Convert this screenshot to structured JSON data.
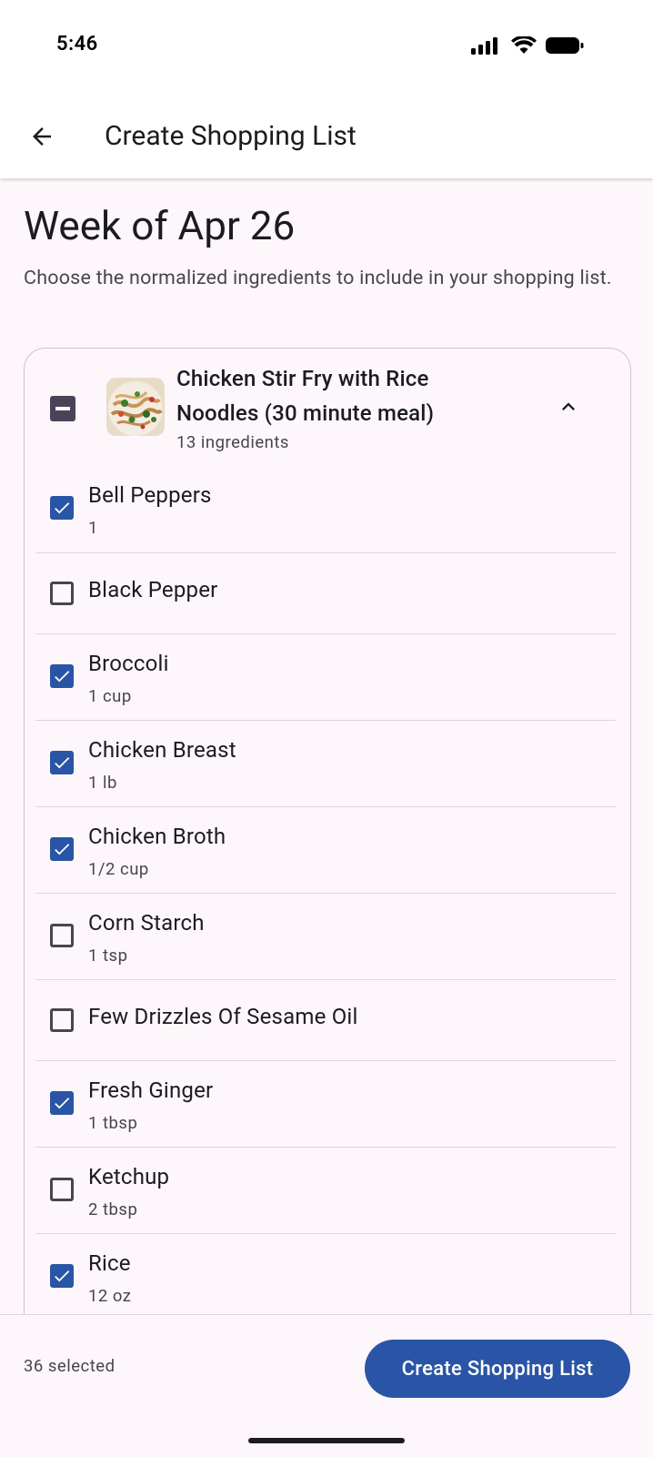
{
  "status_bar": {
    "time": "5:46"
  },
  "app_bar": {
    "title": "Create Shopping List",
    "back_icon": "arrow-left-icon"
  },
  "header": {
    "week_title": "Week of Apr 26",
    "subtitle": "Choose the normalized ingredients to include in your shopping list."
  },
  "recipe": {
    "name": "Chicken Stir Fry with Rice Noodles (30 minute meal)",
    "ingredient_count": "13 ingredients",
    "selection_state": "partial",
    "expanded": true
  },
  "ingredients": [
    {
      "name": "Bell Peppers",
      "qty": "1",
      "checked": true
    },
    {
      "name": "Black Pepper",
      "qty": "",
      "checked": false
    },
    {
      "name": "Broccoli",
      "qty": "1 cup",
      "checked": true
    },
    {
      "name": "Chicken Breast",
      "qty": "1 lb",
      "checked": true
    },
    {
      "name": "Chicken Broth",
      "qty": "1/2 cup",
      "checked": true
    },
    {
      "name": "Corn Starch",
      "qty": "1 tsp",
      "checked": false
    },
    {
      "name": "Few Drizzles Of Sesame Oil",
      "qty": "",
      "checked": false
    },
    {
      "name": "Fresh Ginger",
      "qty": "1 tbsp",
      "checked": true
    },
    {
      "name": "Ketchup",
      "qty": "2 tbsp",
      "checked": false
    },
    {
      "name": "Rice",
      "qty": "12 oz",
      "checked": true
    }
  ],
  "footer": {
    "selected_count": "36 selected",
    "create_button_label": "Create Shopping List"
  },
  "colors": {
    "primary": "#2a55a6",
    "checkbox_partial": "#4a4458",
    "background": "#fdf7fc"
  }
}
